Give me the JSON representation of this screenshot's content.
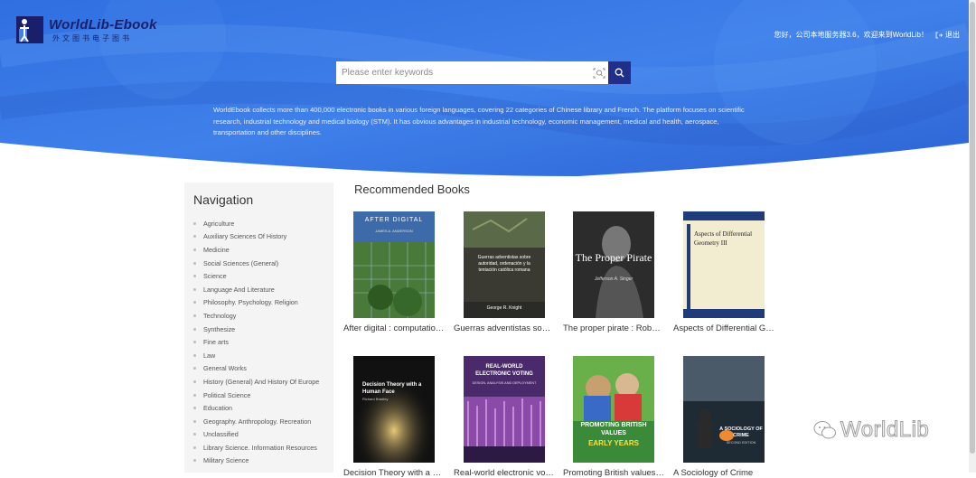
{
  "header": {
    "logo_title": "WorldLib-Ebook",
    "logo_subtitle": "外文图书电子图书",
    "greeting": "您好，公司本地服务器3.6，欢迎来到WorldLib！",
    "logout_label": "退出"
  },
  "search": {
    "placeholder": "Please enter keywords"
  },
  "intro": "WorldEbook collects more than 400,000 electronic books in various foreign languages, covering 22 categories of Chinese library and French. The platform focuses on scientific research, industrial technology and medical biology (STM). It has obvious advantages in industrial technology, economic management, medical and health, aerospace, transportation and other disciplines.",
  "sidebar": {
    "title": "Navigation",
    "items": [
      "Agriculture",
      "Auxiliary Sciences Of History",
      "Medicine",
      "Social Sciences (General)",
      "Science",
      "Language And Literature",
      "Philosophy. Psychology. Religion",
      "Technology",
      "Synthesize",
      "Fine arts",
      "Law",
      "General Works",
      "History (General) And History Of Europe",
      "Political Science",
      "Education",
      "Geography. Anthropology. Recreation",
      "Unclassified",
      "Library Science. Information Resources",
      "Military Science"
    ]
  },
  "recommended": {
    "title": "Recommended Books",
    "books": [
      {
        "title": "After digital : computational theories of literacy and media",
        "cover": {
          "line1": "AFTER DIGITAL",
          "line2": "JAMES A. ANDERSON"
        }
      },
      {
        "title": "Guerras adventistas sobre autoridad, ordenación y la tentación católica romana",
        "cover": {
          "line1": "Guerras adventistas sobre autoridad, ordenación y la tentación católica romana",
          "line2": "George R. Knight"
        }
      },
      {
        "title": "The proper pirate : Robert Louis Stevenson's quest for identity",
        "cover": {
          "line1": "The Proper Pirate",
          "line2": "Jefferson A. Singer"
        }
      },
      {
        "title": "Aspects of Differential Geometry III",
        "cover": {
          "line1": "Aspects of Differential Geometry III"
        }
      },
      {
        "title": "Decision Theory with a Human Face",
        "cover": {
          "line1": "Decision Theory with a Human Face",
          "line2": "Richard Bradley"
        }
      },
      {
        "title": "Real-world electronic voting : design, analysis and deployment",
        "cover": {
          "line1": "REAL-WORLD ELECTRONIC VOTING",
          "line2": "DESIGN, ANALYSIS AND DEPLOYMENT"
        }
      },
      {
        "title": "Promoting British values in the early years",
        "cover": {
          "line1": "PROMOTING BRITISH VALUES",
          "line2": "EARLY YEARS"
        }
      },
      {
        "title": "A Sociology of Crime",
        "cover": {
          "line1": "A SOCIOLOGY OF CRIME",
          "line2": "SECOND EDITION"
        }
      }
    ]
  },
  "watermark": {
    "text": "WorldLib"
  },
  "colors": {
    "hero_blue": "#3a78e0",
    "dark_navy": "#1f2f8a",
    "sidebar_bg": "#f4f4f4"
  }
}
